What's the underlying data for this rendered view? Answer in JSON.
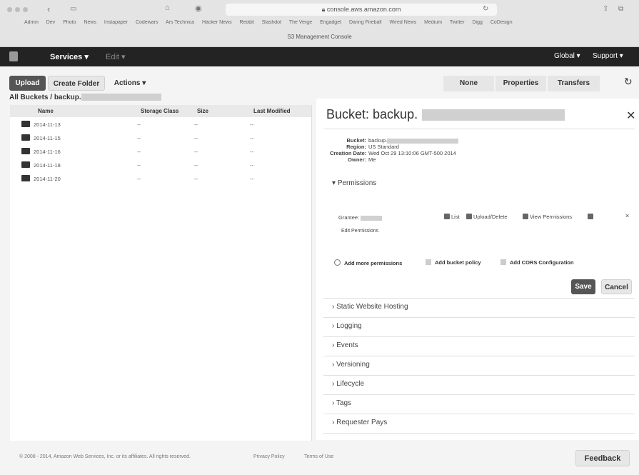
{
  "browser": {
    "url": "console.aws.amazon.com",
    "tab_title": "S3 Management Console",
    "bookmarks": [
      "Admin",
      "Dev",
      "Photo",
      "News",
      "Instapaper",
      "Codewars",
      "Ars Technica",
      "Hacker News",
      "Reddit",
      "Slashdot",
      "The Verge",
      "Engadget",
      "Daring Fireball",
      "Wired News",
      "Medium",
      "Twitter",
      "Digg",
      "CoDesign"
    ]
  },
  "nav": {
    "services": "Services",
    "edit": "Edit",
    "region": "Global",
    "support": "Support"
  },
  "toolbar": {
    "upload": "Upload",
    "create_folder": "Create Folder",
    "actions": "Actions",
    "none": "None",
    "properties": "Properties",
    "transfers": "Transfers"
  },
  "breadcrumb": {
    "root": "All Buckets",
    "bucket": "backup."
  },
  "list": {
    "columns": {
      "name": "Name",
      "storage": "Storage Class",
      "size": "Size",
      "modified": "Last Modified"
    },
    "rows": [
      {
        "name": "2014-11-13",
        "storage": "--",
        "size": "--",
        "modified": "--"
      },
      {
        "name": "2014-11-15",
        "storage": "--",
        "size": "--",
        "modified": "--"
      },
      {
        "name": "2014-11-16",
        "storage": "--",
        "size": "--",
        "modified": "--"
      },
      {
        "name": "2014-11-18",
        "storage": "--",
        "size": "--",
        "modified": "--"
      },
      {
        "name": "2014-11-20",
        "storage": "--",
        "size": "--",
        "modified": "--"
      }
    ]
  },
  "panel": {
    "title": "Bucket: backup.",
    "details": {
      "bucket_label": "Bucket:",
      "bucket_value": "backup.",
      "region_label": "Region:",
      "region_value": "US Standard",
      "created_label": "Creation Date:",
      "created_value": "Wed Oct 29 13:10:06 GMT-500 2014",
      "owner_label": "Owner:",
      "owner_value": "Me"
    },
    "permissions": {
      "heading": "Permissions",
      "grantee_label": "Grantee:",
      "list": "List",
      "upload_delete": "Upload/Delete",
      "view_permissions": "View Permissions",
      "edit_permissions": "Edit Permissions",
      "add_more": "Add more permissions",
      "add_policy": "Add bucket policy",
      "add_cors": "Add CORS Configuration",
      "save": "Save",
      "cancel": "Cancel"
    },
    "sections": [
      "Static Website Hosting",
      "Logging",
      "Events",
      "Versioning",
      "Lifecycle",
      "Tags",
      "Requester Pays"
    ]
  },
  "footer": {
    "copyright": "© 2008 - 2014, Amazon Web Services, Inc. or its affiliates. All rights reserved.",
    "privacy": "Privacy Policy",
    "terms": "Terms of Use",
    "feedback": "Feedback"
  }
}
